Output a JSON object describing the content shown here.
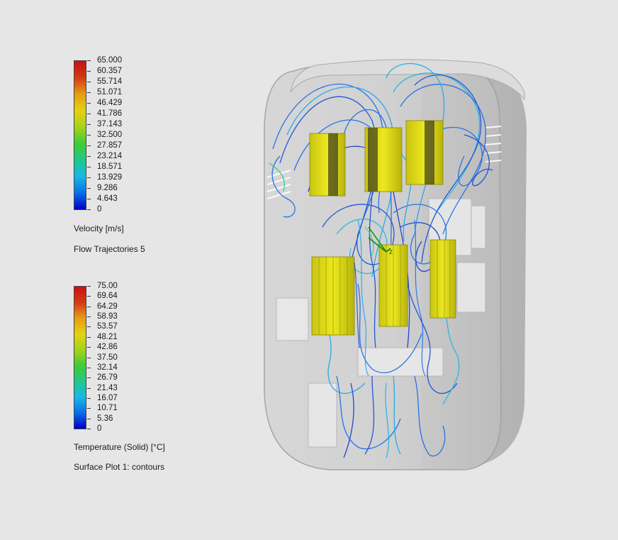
{
  "velocity_legend": {
    "ticks": [
      "65.000",
      "60.357",
      "55.714",
      "51.071",
      "46.429",
      "41.786",
      "37.143",
      "32.500",
      "27.857",
      "23.214",
      "18.571",
      "13.929",
      "9.286",
      "4.643",
      "0"
    ],
    "quantity": "Velocity [m/s]",
    "plot_name": "Flow Trajectories 5",
    "colors": [
      "#0000cc",
      "#0a6fe8",
      "#18b8e8",
      "#1fc98a",
      "#40cc33",
      "#a8d11d",
      "#e2d310",
      "#e89a1a",
      "#d33a13",
      "#cc1010"
    ]
  },
  "temperature_legend": {
    "ticks": [
      "75.00",
      "69.64",
      "64.29",
      "58.93",
      "53.57",
      "48.21",
      "42.86",
      "37.50",
      "32.14",
      "26.79",
      "21.43",
      "16.07",
      "10.71",
      "5.36",
      "0"
    ],
    "quantity": "Temperature (Solid) [°C]",
    "plot_name": "Surface Plot 1: contours",
    "colors": [
      "#0000cc",
      "#0a6fe8",
      "#18b8e8",
      "#1fc98a",
      "#40cc33",
      "#a8d11d",
      "#e2d310",
      "#e89a1a",
      "#d33a13",
      "#cc1010"
    ]
  },
  "model": {
    "axis_label": "z",
    "enclosure_color": "#c9c9c9",
    "heatsink_color": "#e6e21a",
    "streamline_color": "#1a5fe0"
  }
}
